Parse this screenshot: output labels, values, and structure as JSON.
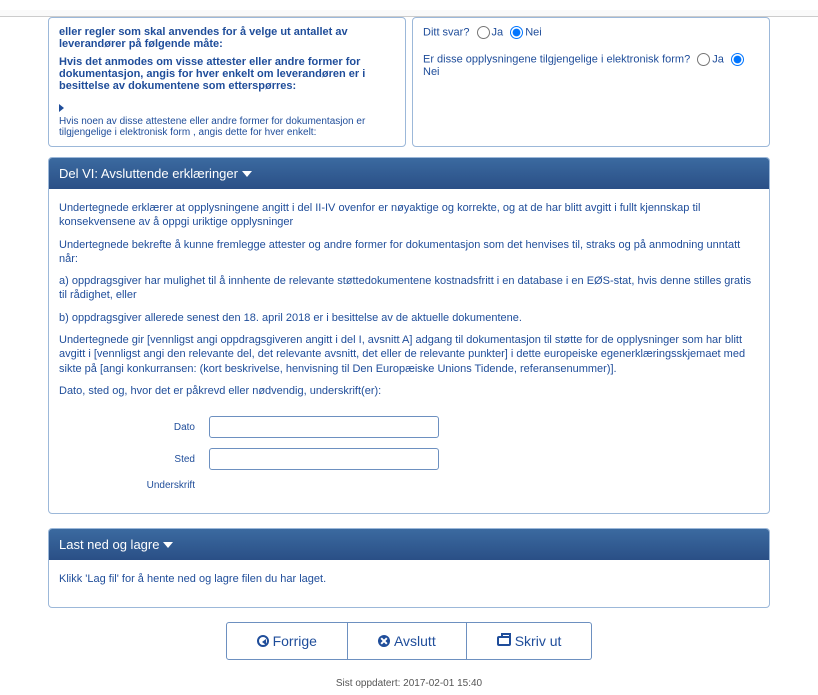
{
  "upper_left": {
    "l1": "eller regler som skal anvendes for å velge ut antallet av",
    "l2": "leverandører på følgende måte:",
    "bold": "Hvis det anmodes om visse attester eller andre former for dokumentasjon, angis for hver enkelt om leverandøren er i besittelse av dokumentene som etterspørres:",
    "note": "Hvis noen av disse attestene eller andre former for dokumentasjon er tilgjengelige i elektronisk form , angis dette for hver enkelt:"
  },
  "upper_right": {
    "q1": "Ditt svar?",
    "q2": "Er disse opplysningene tilgjengelige i elektronisk form?",
    "ja": "Ja",
    "nei": "Nei"
  },
  "section6": {
    "title": "Del VI: Avsluttende erklæringer",
    "p1": "Undertegnede erklærer at opplysningene angitt i del II-IV ovenfor er nøyaktige og korrekte, og at de har blitt avgitt i fullt kjennskap til konsekvensene av å oppgi uriktige opplysninger",
    "p2": "Undertegnede bekrefte å kunne fremlegge attester og andre former for dokumentasjon som det henvises til, straks og på anmodning unntatt når:",
    "p3": "a) oppdragsgiver har mulighet til å innhente de relevante støttedokumentene kostnadsfritt i en database i en EØS-stat, hvis denne stilles gratis til rådighet, eller",
    "p4": "b) oppdragsgiver allerede senest den 18. april 2018 er i besittelse av de aktuelle dokumentene.",
    "p5": "Undertegnede gir [vennligst angi oppdragsgiveren angitt i del I, avsnitt A] adgang til dokumentasjon til støtte for de opplysninger som har blitt avgitt i [vennligst angi den relevante del, det relevante avsnitt, det eller de relevante punkter] i dette europeiske egenerklæringsskjemaet med sikte på [angi konkurransen: (kort beskrivelse, henvisning til Den Europæiske Unions Tidende, referansenummer)].",
    "p6": "Dato, sted og, hvor det er påkrevd eller nødvendig, underskrift(er):",
    "lbl_dato": "Dato",
    "lbl_sted": "Sted",
    "lbl_underskrift": "Underskrift"
  },
  "download": {
    "title": "Last ned og lagre",
    "body": "Klikk 'Lag fil' for å hente ned og lagre filen du har laget."
  },
  "buttons": {
    "prev": "Forrige",
    "cancel": "Avslutt",
    "print": "Skriv ut"
  },
  "footer": "Sist oppdatert: 2017-02-01 15:40"
}
